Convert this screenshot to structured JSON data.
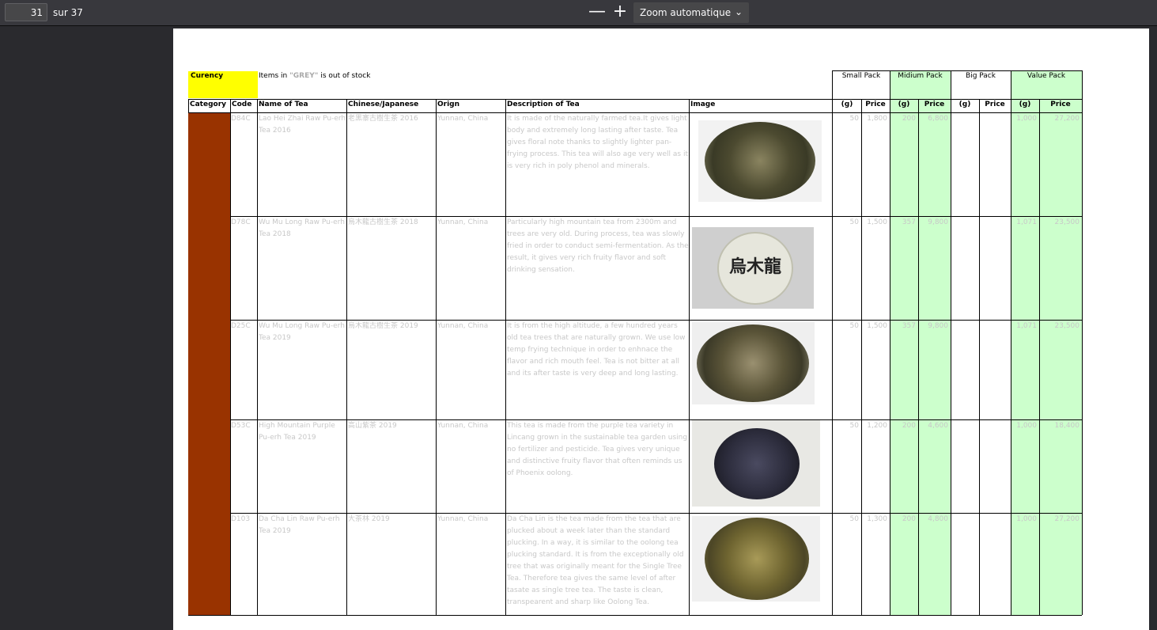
{
  "toolbar": {
    "page_number": "31",
    "page_count": "sur 37",
    "zoom_out": "—",
    "zoom_in": "+",
    "zoom_label": "Zoom automatique",
    "zoom_chevron": "⌄"
  },
  "sheet": {
    "currency_label": "Curency",
    "stock_note_prefix": "Items in ",
    "stock_note_grey": "\"GREY\"",
    "stock_note_suffix": " is out of stock",
    "packs": [
      "Small Pack",
      "Midium Pack",
      "Big Pack",
      "Value Pack"
    ],
    "headers": [
      "Category",
      "Code",
      "Name of Tea",
      "Chinese/Japanese",
      "Orign",
      "Description of Tea",
      "Image"
    ],
    "unit_g": "(g)",
    "unit_price": "Price",
    "rows": [
      {
        "code": "D84C",
        "name": "Lao Hei Zhai Raw Pu-erh Tea 2016",
        "chinese": "老黑寨古樹生茶 2016",
        "origin": "Yunnan, China",
        "description": "It is made of the naturally farmed tea.It gives light body and extremely long lasting after taste. Tea gives floral note thanks to slightly lighter pan-frying process. This tea will also age very well as it is very rich in poly phenol and minerals.",
        "small_g": "50",
        "small_price": "1,800",
        "mid_g": "200",
        "mid_price": "6,800",
        "value_g": "1,000",
        "value_price": "27,200"
      },
      {
        "code": "D78C",
        "name": "Wu Mu Long Raw Pu-erh Tea 2018",
        "chinese": "烏木龍古樹生茶 2018",
        "origin": "Yunnan, China",
        "description": "Particularly high mountain tea from 2300m and trees are very old. During process, tea was slowly fried in order to conduct semi-fermentation. As the result, it gives very rich fruity flavor and soft drinking sensation.",
        "image_text": "烏木龍",
        "small_g": "50",
        "small_price": "1,500",
        "mid_g": "357",
        "mid_price": "9,800",
        "value_g": "1,071",
        "value_price": "23,500"
      },
      {
        "code": "D25C",
        "name": "Wu Mu Long Raw Pu-erh Tea 2019",
        "chinese": "烏木龍古樹生茶 2019",
        "origin": "Yunnan, China",
        "description": "It is from the high altitude, a few hundred years old tea trees that are naturally grown. We use low temp frying technique in order to enhnace the flavor and rich mouth feel. Tea is not bitter at all and its after taste is very deep and long lasting.",
        "small_g": "50",
        "small_price": "1,500",
        "mid_g": "357",
        "mid_price": "9,800",
        "value_g": "1,071",
        "value_price": "23,500"
      },
      {
        "code": "D53C",
        "name": "High Mountain Purple Pu-erh Tea 2019",
        "chinese": "高山紫茶 2019",
        "origin": "Yunnan, China",
        "description": "This tea is made from the purple tea variety in Lincang grown in the sustainable tea garden using no fertilizer and pesticide. Tea gives very unique and distinctive fruity flavor that often reminds us of Phoenix oolong.",
        "small_g": "50",
        "small_price": "1,200",
        "mid_g": "200",
        "mid_price": "4,600",
        "value_g": "1,000",
        "value_price": "18,400"
      },
      {
        "code": "D103",
        "name": "Da Cha Lin Raw Pu-erh Tea 2019",
        "chinese": "大茶林 2019",
        "origin": "Yunnan, China",
        "description": "Da Cha Lin is the tea made from the tea that are plucked about a week later than the standard plucking. In a way, it is similar to the oolong tea plucking standard. It is from the exceptionally old tree that was originally meant for the Single Tree Tea. Therefore tea gives the same level of after tasate as single tree tea. The taste is clean, transpearent and sharp like Oolong Tea.",
        "small_g": "50",
        "small_price": "1,300",
        "mid_g": "200",
        "mid_price": "4,800",
        "value_g": "1,000",
        "value_price": "27,200"
      }
    ]
  },
  "colors": {
    "currency_bg": "#ffff00",
    "category_bg": "#993300",
    "green_col": "#ccffcc",
    "out_of_stock_text": "#c8c8c8"
  }
}
